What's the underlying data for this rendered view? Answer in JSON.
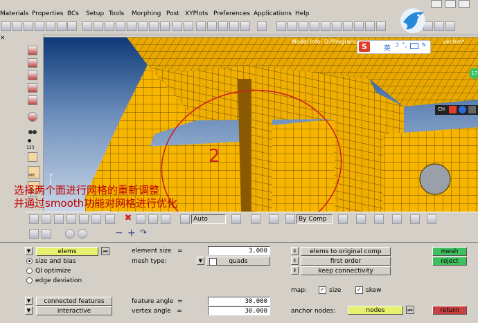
{
  "menu": [
    "Materials",
    "Properties",
    "BCs",
    "Setup",
    "Tools",
    "Morphing",
    "Post",
    "XYPlots",
    "Preferences",
    "Applications",
    "Help"
  ],
  "viewport": {
    "model_label": "Model Info: D:/Program...",
    "model_label_tail": "ver.hm*",
    "axis_y": "Y",
    "annotation_digit": "2",
    "badge": "17"
  },
  "ime": {
    "logo": "S",
    "lang": "英",
    "tray_cn": "CH"
  },
  "left_tools": {
    "count_label": "123",
    "abc1": "ABC",
    "abc2": "ABC"
  },
  "panelbar": {
    "auto_select": "Auto",
    "comp_select": "By Comp"
  },
  "overlay_text": [
    "选择两个面进行网格的重新调整",
    "并通过smooth功能对网格进行优化"
  ],
  "panel": {
    "elems_btn": "elems",
    "element_size_label": "element size",
    "element_size_value": "3.000",
    "mesh_type_label": "mesh type:",
    "mesh_type_value": "quads",
    "radio_size_bias": "size and bias",
    "radio_ql": "QI optimize",
    "radio_edge": "edge deviation",
    "connected_features": "connected features",
    "interactive": "interactive",
    "feature_angle_label": "feature angle",
    "feature_angle_value": "30.000",
    "vertex_angle_label": "vertex angle",
    "vertex_angle_value": "30.000",
    "elems_to_original": "elems to original comp",
    "first_order": "first order",
    "keep_connectivity": "keep connectivity",
    "map_label": "map:",
    "size_check": "size",
    "skew_check": "skew",
    "anchor_nodes_label": "anchor nodes:",
    "nodes_btn": "nodes",
    "mesh_btn": "mesh",
    "reject_btn": "reject",
    "return_btn": "return"
  },
  "colors": {
    "mesh_fill": "#f7b500",
    "green_btn": "#3fbf5f",
    "return_btn": "#c84040",
    "annotation_red": "#c00000",
    "selector_yellow": "#e8f070"
  },
  "icons": [
    "search-icon",
    "rotate-icon",
    "pan-icon",
    "zoom-icon",
    "cube-view-icon",
    "bird-logo-icon"
  ]
}
